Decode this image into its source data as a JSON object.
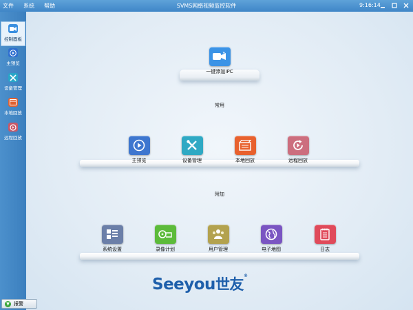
{
  "titlebar": {
    "menu": [
      "文件",
      "系统",
      "帮助"
    ],
    "title": "SVMS网络视频监控软件",
    "clock": "9:16:14"
  },
  "sidebar": {
    "items": [
      {
        "label": "控制面板",
        "icon": "camera-icon",
        "color": "#3a8fe0",
        "active": true
      },
      {
        "label": "主预览",
        "icon": "play-icon",
        "color": "#2f6fd0",
        "active": false
      },
      {
        "label": "设备管理",
        "icon": "tools-icon",
        "color": "#29a6c8",
        "active": false
      },
      {
        "label": "本地回放",
        "icon": "film-icon",
        "color": "#e06030",
        "active": false
      },
      {
        "label": "远程回放",
        "icon": "refresh-play-icon",
        "color": "#c85868",
        "active": false
      }
    ]
  },
  "quick": {
    "label": "一键添加IPC",
    "icon": "camera-icon",
    "color": "#3b93e6"
  },
  "common": {
    "section": "常用",
    "items": [
      {
        "label": "主预览",
        "icon": "play-icon",
        "color": "#3d76cf"
      },
      {
        "label": "设备管理",
        "icon": "tools-icon",
        "color": "#2fa9c4"
      },
      {
        "label": "本地回放",
        "icon": "film-icon",
        "color": "#e8612e"
      },
      {
        "label": "远程回放",
        "icon": "refresh-play-icon",
        "color": "#cc6e7e"
      }
    ]
  },
  "extra": {
    "section": "附加",
    "items": [
      {
        "label": "系统设置",
        "icon": "settings-grid-icon",
        "color": "#6b7fa8"
      },
      {
        "label": "录像计划",
        "icon": "film-reel-icon",
        "color": "#5cbb3a"
      },
      {
        "label": "用户管理",
        "icon": "users-icon",
        "color": "#b3a24e"
      },
      {
        "label": "电子地图",
        "icon": "globe-icon",
        "color": "#7a55c2"
      },
      {
        "label": "日志",
        "icon": "notepad-icon",
        "color": "#e04a5a"
      }
    ]
  },
  "logo": {
    "en": "Seeyou",
    "cn": "世友"
  },
  "alarm": {
    "label": "报警"
  }
}
